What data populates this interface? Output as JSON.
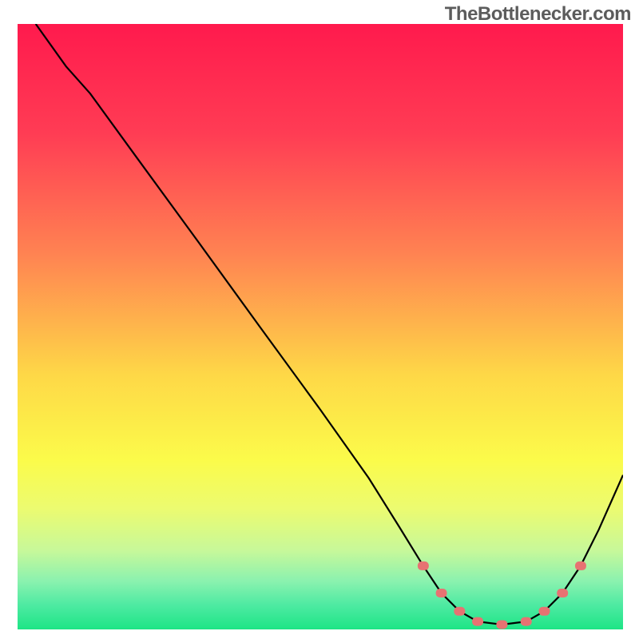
{
  "watermark": "TheBottlenecker.com",
  "chart_data": {
    "type": "line",
    "title": "",
    "xlabel": "",
    "ylabel": "",
    "xlim": [
      0,
      100
    ],
    "ylim": [
      0,
      100
    ],
    "gradient_stops": [
      {
        "offset": 0,
        "color": "#ff1a4d"
      },
      {
        "offset": 18,
        "color": "#ff3c54"
      },
      {
        "offset": 38,
        "color": "#ff8352"
      },
      {
        "offset": 58,
        "color": "#fed847"
      },
      {
        "offset": 72,
        "color": "#fbfb4a"
      },
      {
        "offset": 80,
        "color": "#ecfb70"
      },
      {
        "offset": 87,
        "color": "#c7f89a"
      },
      {
        "offset": 92,
        "color": "#8bf2af"
      },
      {
        "offset": 96,
        "color": "#4eeaa2"
      },
      {
        "offset": 100,
        "color": "#1de586"
      }
    ],
    "curve": [
      {
        "x": 3.0,
        "y": 100.0
      },
      {
        "x": 8.0,
        "y": 93.0
      },
      {
        "x": 12.0,
        "y": 88.5
      },
      {
        "x": 20.0,
        "y": 77.5
      },
      {
        "x": 30.0,
        "y": 63.8
      },
      {
        "x": 40.0,
        "y": 50.0
      },
      {
        "x": 50.0,
        "y": 36.3
      },
      {
        "x": 58.0,
        "y": 25.0
      },
      {
        "x": 63.0,
        "y": 17.0
      },
      {
        "x": 67.0,
        "y": 10.5
      },
      {
        "x": 70.0,
        "y": 6.0
      },
      {
        "x": 73.0,
        "y": 3.0
      },
      {
        "x": 76.0,
        "y": 1.3
      },
      {
        "x": 80.0,
        "y": 0.8
      },
      {
        "x": 84.0,
        "y": 1.3
      },
      {
        "x": 87.0,
        "y": 3.0
      },
      {
        "x": 90.0,
        "y": 6.0
      },
      {
        "x": 93.0,
        "y": 10.5
      },
      {
        "x": 96.0,
        "y": 16.5
      },
      {
        "x": 100.0,
        "y": 25.5
      }
    ],
    "marker_indices": [
      9,
      10,
      11,
      12,
      13,
      14,
      15,
      16,
      17
    ],
    "marker_color": "#e77272",
    "curve_color": "#000000"
  }
}
